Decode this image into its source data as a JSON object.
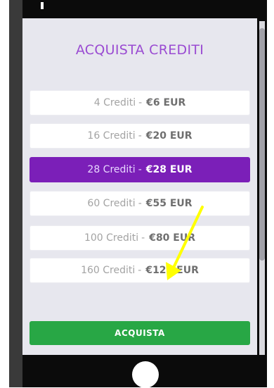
{
  "modal": {
    "title": "ACQUISTA CREDITI",
    "options": [
      {
        "credits": "4 Crediti",
        "separator": "-",
        "price": "€6 EUR"
      },
      {
        "credits": "16 Crediti",
        "separator": "-",
        "price": "€20 EUR"
      },
      {
        "credits": "28 Crediti",
        "separator": "-",
        "price": "€28 EUR"
      },
      {
        "credits": "60 Crediti",
        "separator": "-",
        "price": "€55 EUR"
      },
      {
        "credits": "100 Crediti",
        "separator": "-",
        "price": "€80 EUR"
      },
      {
        "credits": "160 Crediti",
        "separator": "-",
        "price": "€120 EUR"
      }
    ],
    "selected_index": 2,
    "buy_label": "ACQUISTA"
  },
  "colors": {
    "accent_purple": "#7b1fb8",
    "title_purple": "#9a4bd2",
    "buy_green": "#28a745",
    "annotation_arrow": "#ffff00"
  }
}
